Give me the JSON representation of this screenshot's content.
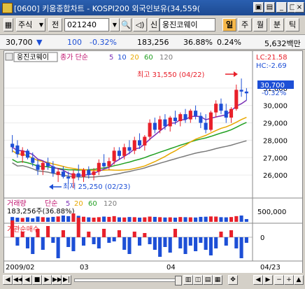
{
  "window": {
    "title": "[0600] 키움종합차트 - KOSPI200 외국인보유(34,559("
  },
  "toolbar": {
    "market_select": "주식",
    "prev_label": "전",
    "code_value": "021240",
    "sin_label": "신",
    "stock_name": "웅진코웨이",
    "period_buttons": [
      "일",
      "주",
      "월",
      "분",
      "틱"
    ]
  },
  "info": {
    "price": "30,700",
    "change_arrow": "▼",
    "change": "100",
    "change_pct": "-0.32%",
    "volume": "183,256",
    "ratio": "36.88%",
    "ratio2": "0.24%",
    "amount": "5,632백만"
  },
  "price_panel": {
    "name_tag": "웅진코웨이",
    "legend_label": "종가 단순",
    "ma_periods": [
      "5",
      "10",
      "20",
      "60",
      "120"
    ],
    "lc_label": "LC:21.58",
    "hc_label": "HC:-2.69",
    "high_annotation": "최고 31,550 (04/22)",
    "low_annotation": "최저 25,250 (02/23)",
    "current_price_tag": "30,700",
    "current_change_tag": "-0.32%",
    "y_ticks": [
      "31,000",
      "30,000",
      "29,000",
      "28,000",
      "27,000",
      "26,000"
    ]
  },
  "volume_panel": {
    "label": "거래량",
    "legend_label": "단순",
    "ma_periods": [
      "5",
      "20",
      "60",
      "120"
    ],
    "value_text": "183,256주(36.88%)",
    "y_tick": "500,000"
  },
  "inst_panel": {
    "label": "기관순매수",
    "y_tick": "0"
  },
  "x_axis": {
    "labels": [
      "2009/02",
      "03",
      "04",
      "04/23"
    ]
  },
  "colors": {
    "up": "#e8202a",
    "down": "#1d4fd6",
    "ma5": "#7b2fb5",
    "ma20": "#e8a800",
    "ma60": "#22a022",
    "ma120": "#7a7a7a"
  },
  "chart_data": {
    "type": "candlestick",
    "title": "웅진코웨이",
    "ylim": [
      25000,
      32000
    ],
    "high": {
      "value": 31550,
      "date": "04/22"
    },
    "low": {
      "value": 25250,
      "date": "02/23"
    },
    "candles": [
      [
        27800,
        28300,
        27300,
        27600
      ],
      [
        27700,
        28000,
        27000,
        27200
      ],
      [
        27100,
        27600,
        26700,
        27400
      ],
      [
        27400,
        27500,
        26900,
        27000
      ],
      [
        27000,
        27300,
        26500,
        26700
      ],
      [
        26600,
        26900,
        26000,
        26300
      ],
      [
        26300,
        26800,
        26000,
        26700
      ],
      [
        26700,
        27000,
        26300,
        26500
      ],
      [
        26500,
        26800,
        25900,
        26100
      ],
      [
        26000,
        26400,
        25600,
        26200
      ],
      [
        26200,
        26500,
        25800,
        25900
      ],
      [
        25900,
        26200,
        25500,
        25800
      ],
      [
        25800,
        26300,
        25250,
        26100
      ],
      [
        26100,
        26600,
        25700,
        25900
      ],
      [
        25900,
        26400,
        25600,
        26300
      ],
      [
        26300,
        26500,
        25800,
        26000
      ],
      [
        26000,
        26400,
        25700,
        26200
      ],
      [
        26200,
        26900,
        26000,
        26700
      ],
      [
        26700,
        27200,
        26400,
        26500
      ],
      [
        26500,
        27000,
        26300,
        26800
      ],
      [
        26800,
        27600,
        26600,
        27400
      ],
      [
        27400,
        27600,
        26900,
        27100
      ],
      [
        27100,
        27800,
        26900,
        27600
      ],
      [
        27600,
        28000,
        27200,
        27400
      ],
      [
        27400,
        28200,
        27200,
        28000
      ],
      [
        28000,
        28400,
        27500,
        27700
      ],
      [
        27700,
        28300,
        27400,
        28200
      ],
      [
        28200,
        29200,
        28000,
        29000
      ],
      [
        29000,
        29300,
        28400,
        28600
      ],
      [
        28600,
        29400,
        28400,
        29200
      ],
      [
        29200,
        29500,
        28600,
        28800
      ],
      [
        28800,
        29400,
        28500,
        29300
      ],
      [
        29300,
        29700,
        28900,
        29100
      ],
      [
        29100,
        29600,
        28800,
        29500
      ],
      [
        29500,
        29800,
        29000,
        29200
      ],
      [
        29200,
        29800,
        29000,
        29700
      ],
      [
        29700,
        30000,
        29200,
        29400
      ],
      [
        29400,
        29600,
        28700,
        29000
      ],
      [
        29000,
        29500,
        28400,
        28600
      ],
      [
        28600,
        29700,
        28500,
        29600
      ],
      [
        29600,
        30300,
        29300,
        30100
      ],
      [
        30100,
        30400,
        29500,
        29700
      ],
      [
        29700,
        30100,
        29000,
        29300
      ],
      [
        29300,
        29900,
        29000,
        29800
      ],
      [
        29800,
        31200,
        29700,
        30900
      ],
      [
        30900,
        31550,
        30500,
        30800
      ],
      [
        30800,
        31000,
        30300,
        30700
      ]
    ],
    "volume": [
      320,
      280,
      260,
      300,
      240,
      350,
      310,
      290,
      330,
      360,
      420,
      380,
      560,
      400,
      340,
      300,
      280,
      310,
      350,
      330,
      380,
      300,
      290,
      320,
      310,
      280,
      300,
      350,
      330,
      310,
      290,
      300,
      280,
      320,
      310,
      300,
      290,
      330,
      340,
      360,
      350,
      310,
      300,
      320,
      380,
      420,
      183
    ],
    "inst_net": [
      120,
      -60,
      40,
      -80,
      -120,
      60,
      -90,
      80,
      -40,
      -150,
      50,
      -70,
      -100,
      140,
      -60,
      40,
      -50,
      -80,
      60,
      -40,
      -30,
      50,
      -90,
      -120,
      40,
      -60,
      30,
      -50,
      -90,
      -140,
      -70,
      -110,
      60,
      -80,
      -120,
      -60,
      -100,
      -40,
      -90,
      -130,
      -80,
      40,
      -60,
      50,
      -80,
      -150,
      -40
    ]
  }
}
